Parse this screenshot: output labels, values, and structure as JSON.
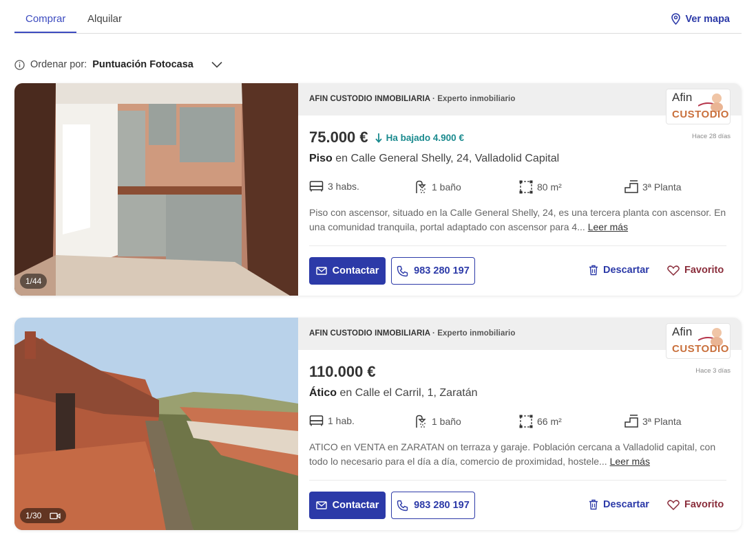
{
  "tabs": {
    "buy": "Comprar",
    "rent": "Alquilar",
    "map": "Ver mapa"
  },
  "sort": {
    "label": "Ordenar por:",
    "value": "Puntuación Fotocasa"
  },
  "listings": [
    {
      "agency": "AFIN CUSTODIO INMOBILIARIA",
      "agency_tag": "· Experto inmobiliario",
      "logo_top": "Afin",
      "logo_bottom": "CUSTODIO",
      "price": "75.000 €",
      "price_drop": "Ha bajado 4.900 €",
      "ago": "Hace 28 días",
      "type": "Piso",
      "address": "en Calle General Shelly, 24, Valladolid Capital",
      "rooms": "3 habs.",
      "baths": "1 baño",
      "area": "80 m²",
      "floor": "3ª Planta",
      "description": "Piso con ascensor, situado en la Calle General Shelly, 24, es una tercera planta con ascensor. En una comunidad tranquila, portal adaptado con ascensor para 4...",
      "read_more": "Leer más",
      "photo_counter": "1/44",
      "contact": "Contactar",
      "phone": "983 280 197",
      "discard": "Descartar",
      "favorite": "Favorito"
    },
    {
      "agency": "AFIN CUSTODIO INMOBILIARIA",
      "agency_tag": "· Experto inmobiliario",
      "logo_top": "Afin",
      "logo_bottom": "CUSTODIO",
      "price": "110.000 €",
      "ago": "Hace 3 días",
      "type": "Ático",
      "address": "en Calle el Carril, 1, Zaratán",
      "rooms": "1 hab.",
      "baths": "1 baño",
      "area": "66 m²",
      "floor": "3ª Planta",
      "description": "ATICO en VENTA en ZARATAN on terraza y garaje. Población cercana a Valladolid capital, con todo lo necesario para el día a día, comercio de proximidad, hostele...",
      "read_more": "Leer más",
      "photo_counter": "1/30",
      "contact": "Contactar",
      "phone": "983 280 197",
      "discard": "Descartar",
      "favorite": "Favorito"
    }
  ],
  "colors": {
    "primary": "#2c3aa8",
    "drop": "#1a8a8e",
    "favorite": "#8a2d3b",
    "logo_orange": "#c9703c"
  },
  "icons": [
    "location-pin-icon",
    "info-icon",
    "chevron-down-icon",
    "arrow-down-icon",
    "bed-icon",
    "shower-icon",
    "area-icon",
    "floor-icon",
    "mail-icon",
    "phone-icon",
    "trash-icon",
    "heart-icon",
    "video-icon"
  ]
}
